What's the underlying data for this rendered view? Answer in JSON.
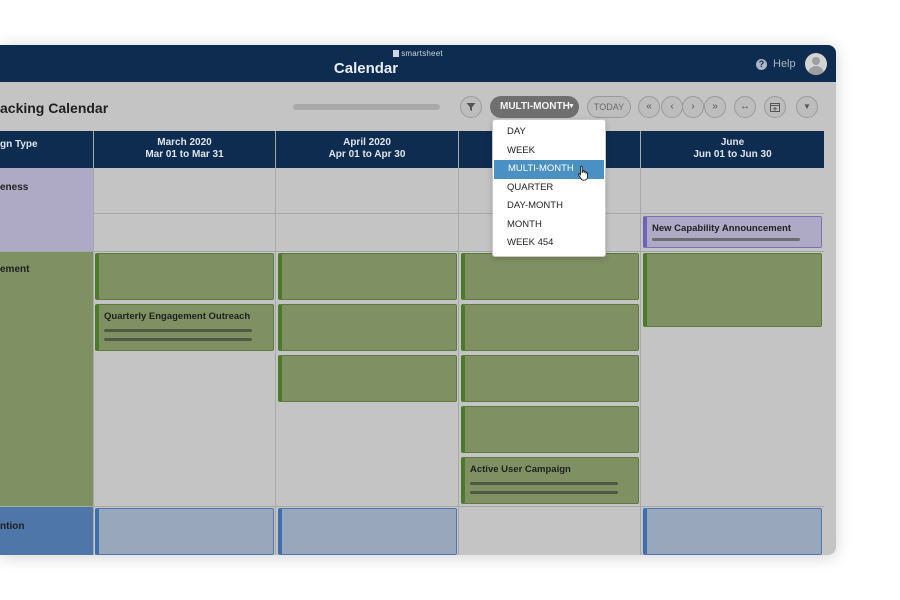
{
  "header": {
    "brand": "smartsheet",
    "app_title": "Calendar",
    "help_label": "Help"
  },
  "toolbar": {
    "calendar_title": "acking Calendar",
    "view_selected": "MULTI-MONTH",
    "today_label": "TODAY"
  },
  "view_menu": {
    "options": [
      "DAY",
      "WEEK",
      "MULTI-MONTH",
      "QUARTER",
      "DAY-MONTH",
      "MONTH",
      "WEEK 454"
    ],
    "selected": "MULTI-MONTH"
  },
  "columns": {
    "type_header": "gn Type",
    "months": [
      {
        "name": "March 2020",
        "range": "Mar 01 to Mar 31"
      },
      {
        "name": "April 2020",
        "range": "Apr 01 to Apr 30"
      },
      {
        "name": "",
        "range": ""
      },
      {
        "name": "June",
        "range": "Jun 01 to Jun 30"
      }
    ]
  },
  "rows": [
    {
      "label": "eness",
      "color": "#aeaac5"
    },
    {
      "label": "ement",
      "color": "#7f9163"
    },
    {
      "label": "ntion",
      "color": "#4f76a8"
    }
  ],
  "cards": {
    "quarterly": "Quarterly Engagement Outreach",
    "active_user": "Active User Campaign",
    "new_capability": "New Capability Announcement"
  },
  "colors": {
    "header_navy": "#0d2c4f",
    "engagement_green": "#7f9163",
    "retention_blue": "#4f76a8",
    "awareness_purple": "#aeaac5",
    "selection_blue": "#4a90c2"
  },
  "icons": [
    "filter-icon",
    "first-page-icon",
    "prev-icon",
    "next-icon",
    "last-page-icon",
    "expand-icon",
    "calendar-add-icon",
    "more-icon",
    "help-icon",
    "hand-cursor-icon"
  ]
}
